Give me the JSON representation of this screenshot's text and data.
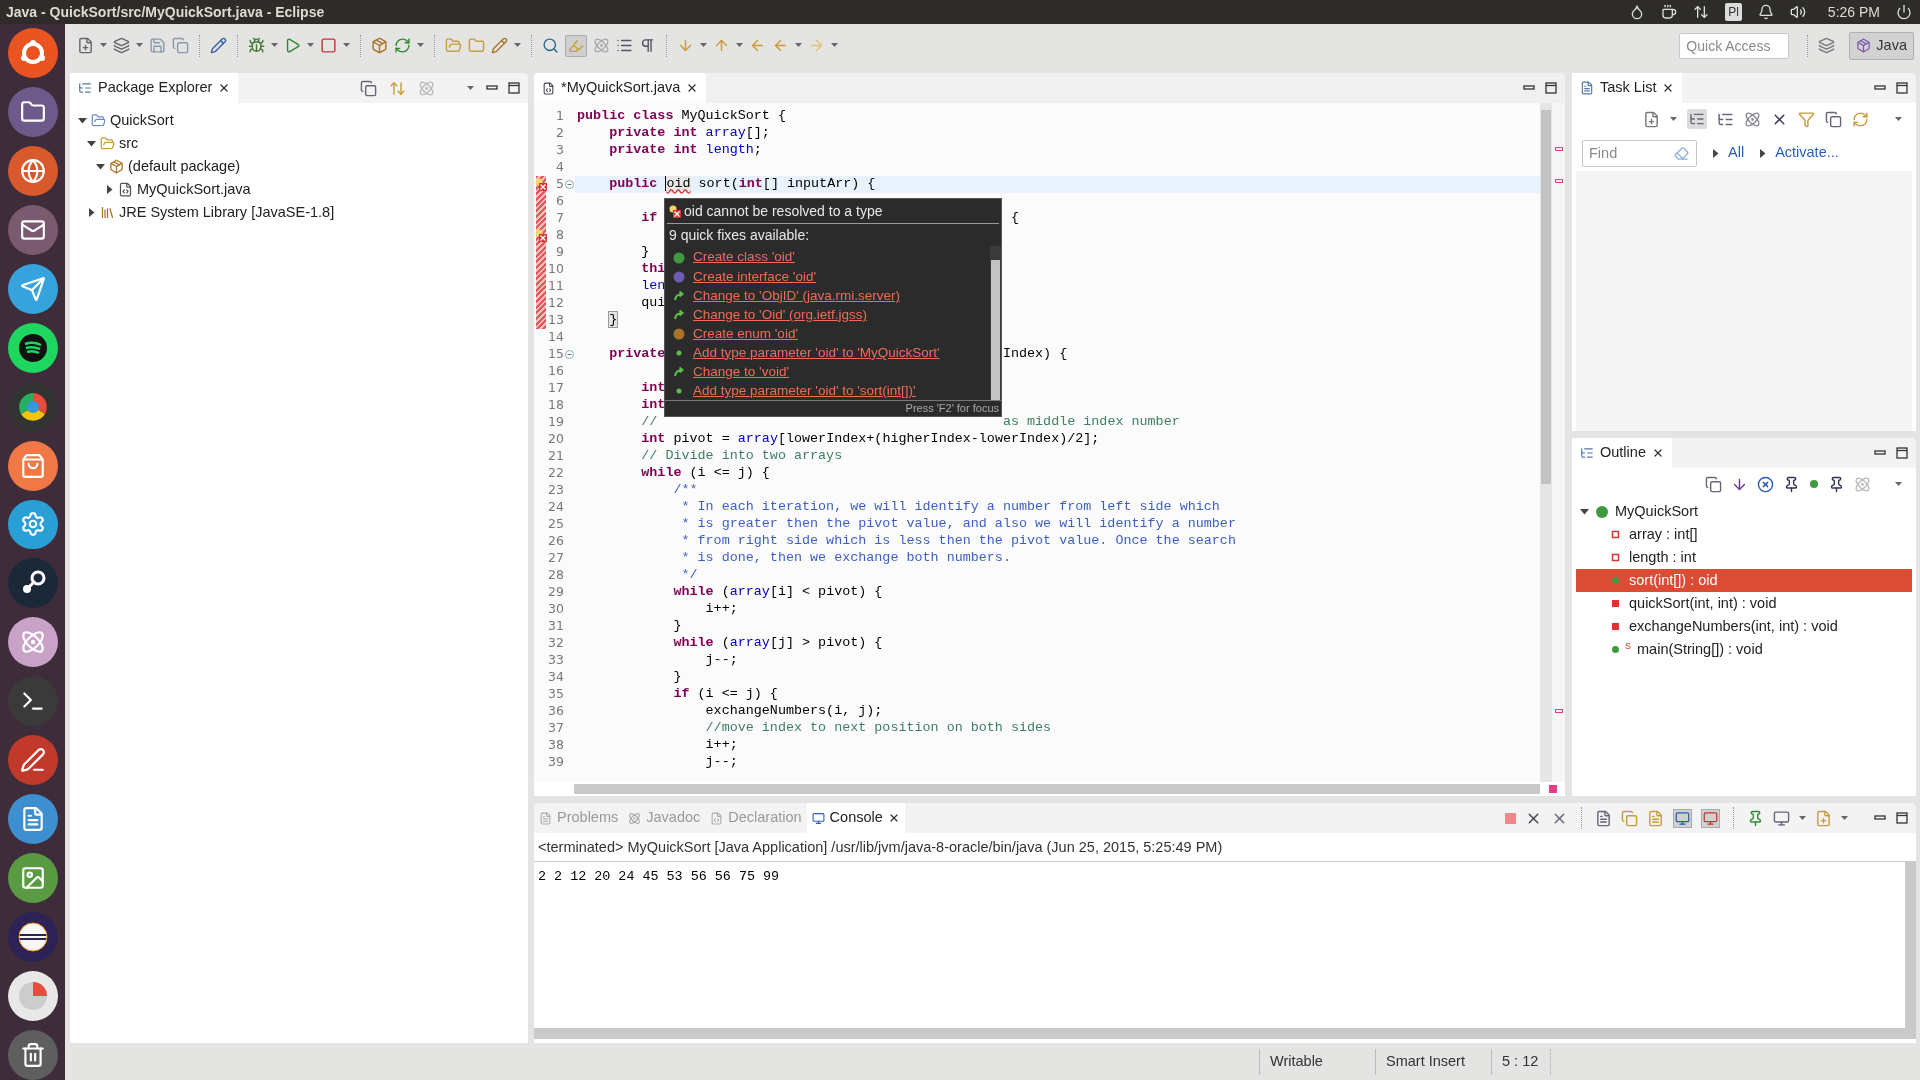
{
  "window": {
    "title": "Java - QuickSort/src/MyQuickSort.java - Eclipse"
  },
  "top_panel": {
    "indicator": "Pl",
    "clock": "5:26 PM"
  },
  "toolbar": {
    "quick_access": {
      "placeholder": "Quick Access"
    },
    "perspectives": [
      {
        "label": "Java",
        "selected": true
      }
    ]
  },
  "package_explorer": {
    "title": "Package Explorer",
    "tree": [
      {
        "label": "QuickSort",
        "kind": "project",
        "expanded": true,
        "children": [
          {
            "label": "src",
            "kind": "source",
            "expanded": true,
            "children": [
              {
                "label": "(default package)",
                "kind": "package",
                "expanded": true,
                "children": [
                  {
                    "label": "MyQuickSort.java",
                    "kind": "file",
                    "expanded": false
                  }
                ]
              }
            ]
          },
          {
            "label": "JRE System Library [JavaSE-1.8]",
            "kind": "library",
            "expanded": false
          }
        ]
      }
    ]
  },
  "editor": {
    "tabs": [
      {
        "label": "*MyQuickSort.java",
        "selected": true
      }
    ],
    "lines": [
      {
        "n": "1",
        "tokens": [
          {
            "kind": "kw",
            "text": "public"
          },
          {
            "kind": "kw",
            "text": " class"
          },
          {
            "kind": "txt",
            "text": " MyQuickSort {"
          }
        ]
      },
      {
        "n": "2",
        "tokens": [
          {
            "kind": "kw",
            "text": "    private"
          },
          {
            "kind": "kw",
            "text": " int"
          },
          {
            "kind": "field",
            "text": " array"
          },
          {
            "kind": "txt",
            "text": "[];"
          }
        ]
      },
      {
        "n": "3",
        "tokens": [
          {
            "kind": "kw",
            "text": "    private"
          },
          {
            "kind": "kw",
            "text": " int"
          },
          {
            "kind": "field",
            "text": " length"
          },
          {
            "kind": "txt",
            "text": ";"
          }
        ]
      },
      {
        "n": "4"
      },
      {
        "n": "5",
        "error": true,
        "fold": true,
        "current": true,
        "changed": true,
        "tokens": [
          {
            "kind": "kw",
            "text": "    public "
          },
          {
            "kind": "err",
            "text": "oid"
          },
          {
            "kind": "txt",
            "text": " sort("
          },
          {
            "kind": "kw",
            "text": "int"
          },
          {
            "kind": "txt",
            "text": "[] inputArr) {"
          }
        ]
      },
      {
        "n": "6",
        "changed": true
      },
      {
        "n": "7",
        "changed": true,
        "tokens": [
          {
            "kind": "kw",
            "text": "        if"
          },
          {
            "kind": "txt",
            "text": "                                            {"
          }
        ]
      },
      {
        "n": "8",
        "error": true,
        "changed": true
      },
      {
        "n": "9",
        "changed": true,
        "tokens": [
          {
            "kind": "txt",
            "text": "        }"
          }
        ]
      },
      {
        "n": "10",
        "changed": true,
        "tokens": [
          {
            "kind": "kw",
            "text": "        thi"
          }
        ]
      },
      {
        "n": "11",
        "changed": true,
        "tokens": [
          {
            "kind": "field",
            "text": "        len"
          }
        ]
      },
      {
        "n": "12",
        "changed": true,
        "tokens": [
          {
            "kind": "txt",
            "text": "        qui"
          }
        ]
      },
      {
        "n": "13",
        "changed": true,
        "tokens": [
          {
            "kind": "match",
            "text": "    }"
          }
        ]
      },
      {
        "n": "14"
      },
      {
        "n": "15",
        "fold": true,
        "tokens": [
          {
            "kind": "kw",
            "text": "    private"
          },
          {
            "kind": "txt",
            "text": "                                          Index) {"
          }
        ]
      },
      {
        "n": "16"
      },
      {
        "n": "17",
        "tokens": [
          {
            "kind": "kw",
            "text": "        int"
          }
        ]
      },
      {
        "n": "18",
        "tokens": [
          {
            "kind": "kw",
            "text": "        int"
          }
        ]
      },
      {
        "n": "19",
        "tokens": [
          {
            "kind": "com",
            "text": "        //"
          },
          {
            "kind": "com",
            "text": "                                           as middle index number"
          }
        ]
      },
      {
        "n": "20",
        "tokens": [
          {
            "kind": "kw",
            "text": "        int"
          },
          {
            "kind": "txt",
            "text": " pivot = "
          },
          {
            "kind": "field",
            "text": "array"
          },
          {
            "kind": "txt",
            "text": "[lowerIndex+(higherIndex-lowerIndex)/2];"
          }
        ]
      },
      {
        "n": "21",
        "tokens": [
          {
            "kind": "com",
            "text": "        // Divide into two arrays"
          }
        ]
      },
      {
        "n": "22",
        "tokens": [
          {
            "kind": "kw",
            "text": "        while"
          },
          {
            "kind": "txt",
            "text": " (i <= j) {"
          }
        ]
      },
      {
        "n": "23",
        "tokens": [
          {
            "kind": "doc",
            "text": "            /**"
          }
        ]
      },
      {
        "n": "24",
        "tokens": [
          {
            "kind": "doc",
            "text": "             * In each iteration, we will identify a number from left side which"
          }
        ]
      },
      {
        "n": "25",
        "tokens": [
          {
            "kind": "doc",
            "text": "             * is greater then the pivot value, and also we will identify a number"
          }
        ]
      },
      {
        "n": "26",
        "tokens": [
          {
            "kind": "doc",
            "text": "             * from right side which is less then the pivot value. Once the search"
          }
        ]
      },
      {
        "n": "27",
        "tokens": [
          {
            "kind": "doc",
            "text": "             * is done, then we exchange both numbers."
          }
        ]
      },
      {
        "n": "28",
        "tokens": [
          {
            "kind": "doc",
            "text": "             */"
          }
        ]
      },
      {
        "n": "29",
        "tokens": [
          {
            "kind": "kw",
            "text": "            while"
          },
          {
            "kind": "txt",
            "text": " ("
          },
          {
            "kind": "field",
            "text": "array"
          },
          {
            "kind": "txt",
            "text": "[i] < pivot) {"
          }
        ]
      },
      {
        "n": "30",
        "tokens": [
          {
            "kind": "txt",
            "text": "                i++;"
          }
        ]
      },
      {
        "n": "31",
        "tokens": [
          {
            "kind": "txt",
            "text": "            }"
          }
        ]
      },
      {
        "n": "32",
        "tokens": [
          {
            "kind": "kw",
            "text": "            while"
          },
          {
            "kind": "txt",
            "text": " ("
          },
          {
            "kind": "field",
            "text": "array"
          },
          {
            "kind": "txt",
            "text": "[j] > pivot) {"
          }
        ]
      },
      {
        "n": "33",
        "tokens": [
          {
            "kind": "txt",
            "text": "                j--;"
          }
        ]
      },
      {
        "n": "34",
        "tokens": [
          {
            "kind": "txt",
            "text": "            }"
          }
        ]
      },
      {
        "n": "35",
        "tokens": [
          {
            "kind": "kw",
            "text": "            if"
          },
          {
            "kind": "txt",
            "text": " (i <= j) {"
          }
        ]
      },
      {
        "n": "36",
        "tokens": [
          {
            "kind": "txt",
            "text": "                exchangeNumbers(i, j);"
          }
        ]
      },
      {
        "n": "37",
        "tokens": [
          {
            "kind": "com",
            "text": "                //move index to next position on both sides"
          }
        ]
      },
      {
        "n": "38",
        "tokens": [
          {
            "kind": "txt",
            "text": "                i++;"
          }
        ]
      },
      {
        "n": "39",
        "tokens": [
          {
            "kind": "txt",
            "text": "                j--;"
          }
        ]
      }
    ],
    "quick_fix": {
      "message": "oid cannot be resolved to a type",
      "summary": "9 quick fixes available:",
      "fixes": [
        {
          "kind": "class",
          "label": "Create class 'oid'"
        },
        {
          "kind": "interface",
          "label": "Create interface 'oid'"
        },
        {
          "kind": "change",
          "label": "Change to 'ObjID' (java.rmi.server)"
        },
        {
          "kind": "change",
          "label": "Change to 'Oid' (org.ietf.jgss)"
        },
        {
          "kind": "enum",
          "label": "Create enum 'oid'"
        },
        {
          "kind": "param",
          "label": "Add type parameter 'oid' to 'MyQuickSort'"
        },
        {
          "kind": "change",
          "label": "Change to 'void'"
        },
        {
          "kind": "param",
          "label": "Add type parameter 'oid' to 'sort(int[])'"
        }
      ],
      "hint": "Press 'F2' for focus"
    }
  },
  "task_list": {
    "title": "Task List",
    "find": {
      "placeholder": "Find"
    },
    "links": [
      "All",
      "Activate..."
    ]
  },
  "outline": {
    "title": "Outline",
    "tree": [
      {
        "label": "MyQuickSort",
        "kind": "class",
        "expanded": true,
        "selected": false,
        "children": [
          {
            "label": "array : int[]",
            "kind": "private_field",
            "selected": false
          },
          {
            "label": "length : int",
            "kind": "private_field",
            "selected": false
          },
          {
            "label": "sort(int[]) : oid",
            "kind": "public_method",
            "selected": true
          },
          {
            "label": "quickSort(int, int) : void",
            "kind": "private_method",
            "selected": false
          },
          {
            "label": "exchangeNumbers(int, int) : void",
            "kind": "private_method",
            "selected": false
          },
          {
            "label": "main(String[]) : void",
            "kind": "public_method",
            "badge": "S",
            "selected": false
          }
        ]
      }
    ]
  },
  "console": {
    "tabs": [
      {
        "label": "Problems",
        "kind": "problems",
        "selected": false
      },
      {
        "label": "Javadoc",
        "kind": "javadoc",
        "selected": false
      },
      {
        "label": "Declaration",
        "kind": "declaration",
        "selected": false
      },
      {
        "label": "Console",
        "kind": "console",
        "selected": true
      }
    ],
    "header": "<terminated> MyQuickSort [Java Application] /usr/lib/jvm/java-8-oracle/bin/java (Jun 25, 2015, 5:25:49 PM)",
    "output": "2 2 12 20 24 45 53 56 56 75 99"
  },
  "status_bar": {
    "fields": [
      "Writable",
      "Smart Insert",
      "5 : 12"
    ]
  }
}
